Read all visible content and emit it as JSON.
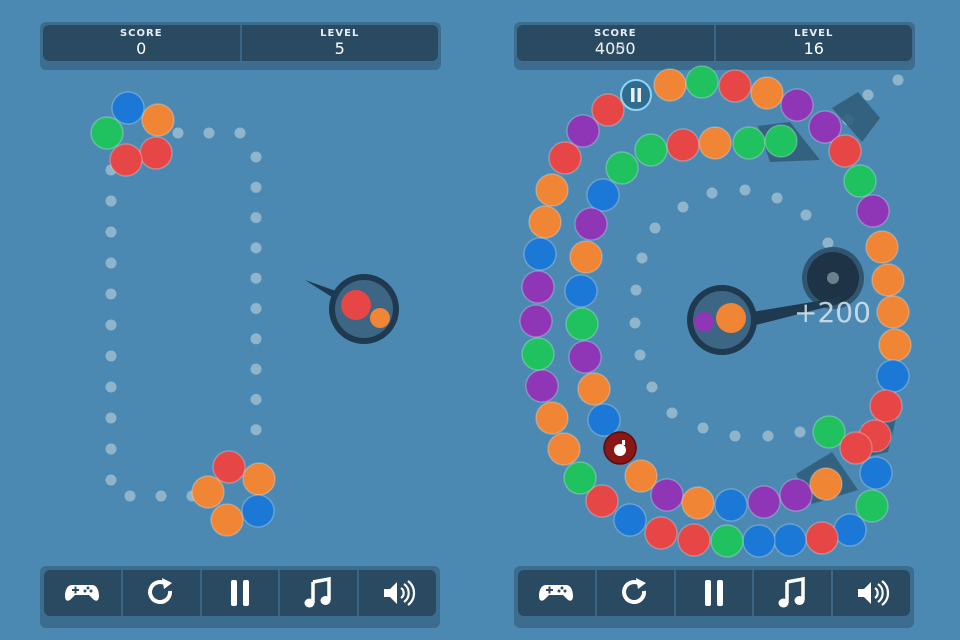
{
  "palette": {
    "red": "#e64646",
    "orange": "#f08536",
    "green": "#1fc25e",
    "blue": "#1b78d6",
    "purple": "#8e36b5",
    "bomb": "#8a1616",
    "background": "#4b89b2",
    "panel": "#2a4a62"
  },
  "left_game": {
    "hud": {
      "score_label": "SCORE",
      "score": "0",
      "level_label": "LEVEL",
      "level": "5"
    },
    "chain_top": [
      "blue",
      "orange",
      "green",
      "red",
      "red"
    ],
    "chain_bottom": [
      "red",
      "orange",
      "orange",
      "blue",
      "orange"
    ],
    "shooter": {
      "current": "red",
      "next": "orange"
    },
    "toolbar": [
      "gamepad-icon",
      "restart-icon",
      "pause-icon",
      "music-icon",
      "sound-icon"
    ]
  },
  "right_game": {
    "hud": {
      "score_label": "SCORE",
      "score": "4050",
      "score_previous": "4000",
      "level_label": "LEVEL",
      "level": "16"
    },
    "outer_chain": [
      "red",
      "orange",
      "green",
      "red",
      "orange",
      "purple",
      "purple",
      "red",
      "green",
      "purple",
      "orange",
      "orange",
      "orange",
      "orange",
      "blue",
      "red",
      "red",
      "blue",
      "green",
      "blue",
      "red",
      "blue",
      "blue",
      "green",
      "red",
      "red",
      "blue",
      "red",
      "green",
      "orange",
      "orange",
      "purple",
      "green",
      "purple",
      "purple",
      "blue",
      "orange",
      "orange",
      "red",
      "purple"
    ],
    "inner_chain": [
      "green",
      "green",
      "red",
      "orange",
      "green",
      "green",
      "blue",
      "purple",
      "orange",
      "blue",
      "green",
      "purple",
      "orange",
      "blue",
      "bomb",
      "orange",
      "purple",
      "orange",
      "blue",
      "purple",
      "purple",
      "orange",
      "green",
      "red"
    ],
    "shooter": {
      "current": "orange",
      "next": "purple"
    },
    "score_popup": "+200",
    "toolbar": [
      "gamepad-icon",
      "restart-icon",
      "pause-icon",
      "music-icon",
      "sound-icon"
    ]
  }
}
